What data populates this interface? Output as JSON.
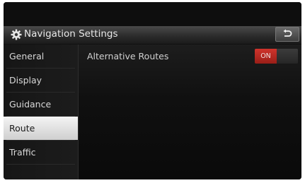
{
  "header": {
    "title": "Navigation Settings",
    "title_icon": "gear-icon",
    "back_icon": "back-arrow-icon"
  },
  "sidebar": {
    "items": [
      {
        "label": "General",
        "selected": false
      },
      {
        "label": "Display",
        "selected": false
      },
      {
        "label": "Guidance",
        "selected": false
      },
      {
        "label": "Route",
        "selected": true
      },
      {
        "label": "Traffic",
        "selected": false
      }
    ]
  },
  "settings": {
    "options": [
      {
        "label": "Alternative Routes",
        "state": "ON"
      }
    ]
  },
  "colors": {
    "toggle_on": "#c0302a",
    "selected_item": "#e6e6e6"
  }
}
